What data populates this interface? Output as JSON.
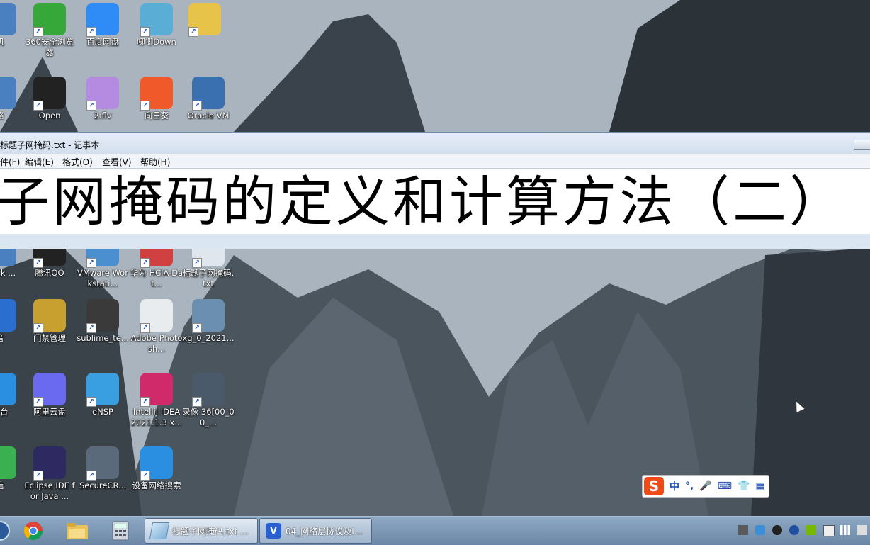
{
  "desktop": {
    "icons": [
      {
        "label": "机",
        "color": "#4a7fc0"
      },
      {
        "label": "360安全浏览器",
        "color": "#36a83a"
      },
      {
        "label": "百度网盘",
        "color": "#2f8bf5"
      },
      {
        "label": "唧唧Down",
        "color": "#5aaed6"
      },
      {
        "label": "",
        "color": "#e8c34a"
      },
      {
        "label": "络",
        "color": "#4a7fc0"
      },
      {
        "label": "Open",
        "color": "#222222"
      },
      {
        "label": "2.flv",
        "color": "#b48be0"
      },
      {
        "label": "向日葵",
        "color": "#f05a2a"
      },
      {
        "label": "Oracle VM",
        "color": "#3a6fb0"
      },
      {
        "label": "re - k ...",
        "color": "#4a7fc0"
      },
      {
        "label": "腾讯QQ",
        "color": "#222222"
      },
      {
        "label": "VMware Workstati...",
        "color": "#4a8fd0"
      },
      {
        "label": "华为 HCIA-Dat...",
        "color": "#d04040"
      },
      {
        "label": "标题子网掩码.txt",
        "color": "#e0e6ee"
      },
      {
        "label": "音",
        "color": "#2a6fd0"
      },
      {
        "label": "门禁管理",
        "color": "#c8a030"
      },
      {
        "label": "sublime_te...",
        "color": "#3a3a3a"
      },
      {
        "label": "Adobe Photosh...",
        "color": "#e8ecef"
      },
      {
        "label": "xg_0_2021...",
        "color": "#6a8fb0"
      },
      {
        "label": "作台",
        "color": "#2a8fe0"
      },
      {
        "label": "阿里云盘",
        "color": "#6a6af0"
      },
      {
        "label": "eNSP",
        "color": "#3a9fe0"
      },
      {
        "label": "IntelliJ IDEA 2021.1.3 x...",
        "color": "#d02a6a"
      },
      {
        "label": "录像 36[00_00_...",
        "color": "#4a5a6a"
      },
      {
        "label": "信",
        "color": "#3ab050"
      },
      {
        "label": "Eclipse IDE for Java ...",
        "color": "#2c2a60"
      },
      {
        "label": "SecureCR...",
        "color": "#5a6a7a"
      },
      {
        "label": "设备网络搜索",
        "color": "#2a8fe0"
      }
    ]
  },
  "notepad": {
    "title": "标题子网掩码.txt - 记事本",
    "menus": [
      "件(F)",
      "编辑(E)",
      "格式(O)",
      "查看(V)",
      "帮助(H)"
    ],
    "content": "子网掩码的定义和计算方法（二）"
  },
  "ime": {
    "logo": "S",
    "items": [
      "中",
      "°,",
      "🎤",
      "⌨",
      "👕",
      "▦"
    ]
  },
  "taskbar": {
    "tasks": [
      {
        "label": "标题子网掩码.txt ...",
        "active": true
      },
      {
        "label": "04_网络层协议及I...",
        "active": false
      }
    ]
  }
}
